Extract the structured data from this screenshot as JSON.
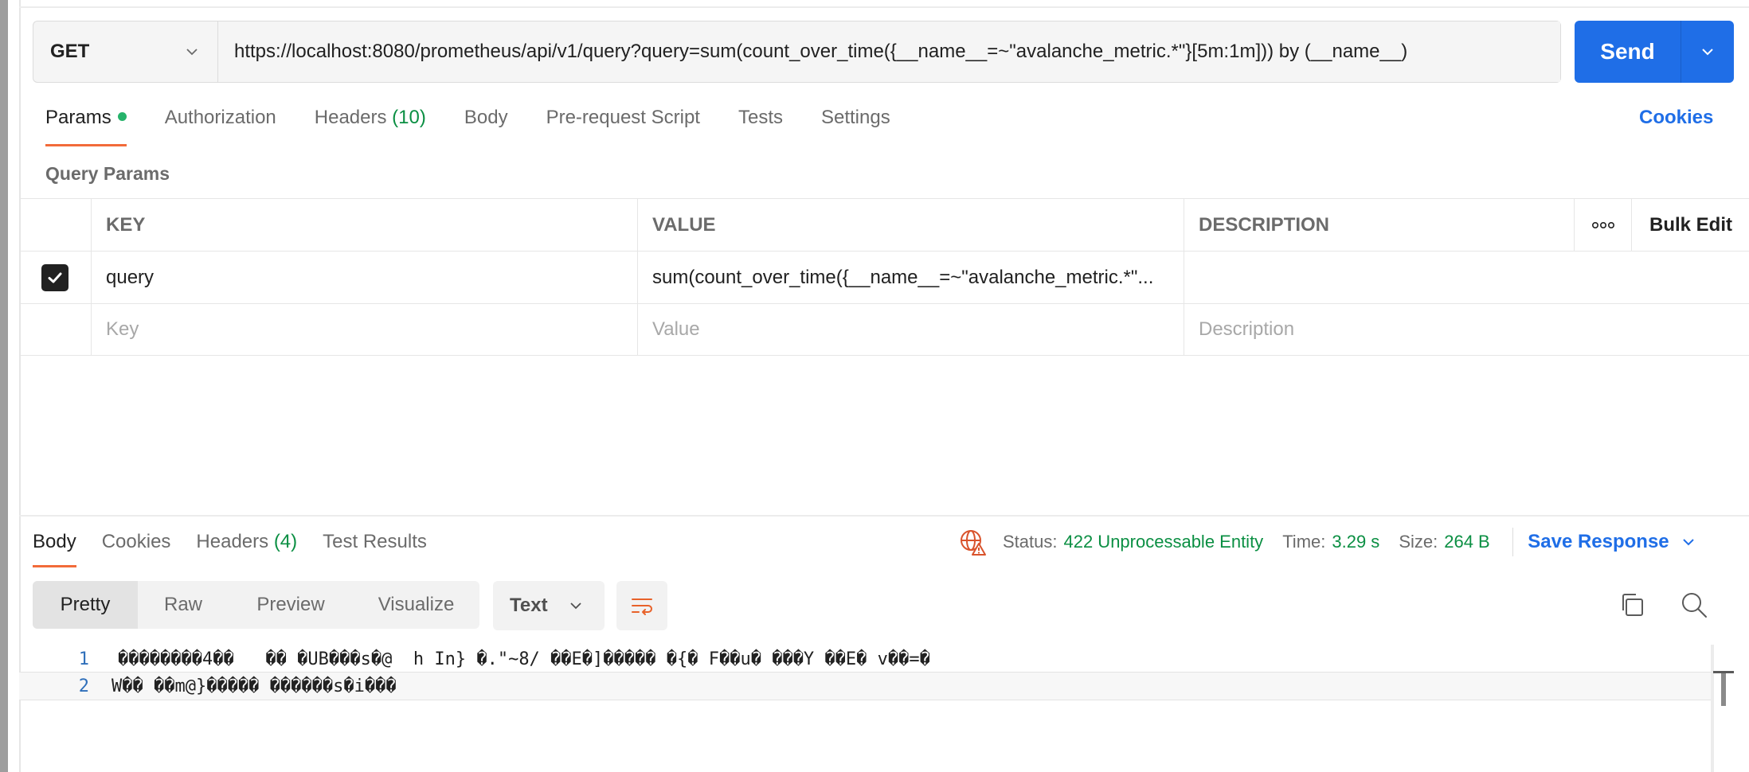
{
  "request": {
    "method": "GET",
    "url": "https://localhost:8080/prometheus/api/v1/query?query=sum(count_over_time({__name__=~\"avalanche_metric.*\"}[5m:1m])) by (__name__)",
    "send_label": "Send"
  },
  "tabs": {
    "params": "Params",
    "authorization": "Authorization",
    "headers": "Headers",
    "headers_count": "(10)",
    "body": "Body",
    "prerequest": "Pre-request Script",
    "tests": "Tests",
    "settings": "Settings",
    "cookies": "Cookies"
  },
  "params": {
    "title": "Query Params",
    "columns": {
      "key": "KEY",
      "value": "VALUE",
      "description": "DESCRIPTION",
      "bulk_edit": "Bulk Edit"
    },
    "rows": [
      {
        "key": "query",
        "value": "sum(count_over_time({__name__=~\"avalanche_metric.*\"...",
        "description": "",
        "checked": true
      }
    ],
    "placeholder": {
      "key": "Key",
      "value": "Value",
      "description": "Description"
    }
  },
  "response": {
    "tabs": {
      "body": "Body",
      "cookies": "Cookies",
      "headers": "Headers",
      "headers_count": "(4)",
      "test_results": "Test Results"
    },
    "status_label": "Status:",
    "status_value": "422 Unprocessable Entity",
    "time_label": "Time:",
    "time_value": "3.29 s",
    "size_label": "Size:",
    "size_value": "264 B",
    "save_response": "Save Response",
    "formats": [
      "Pretty",
      "Raw",
      "Preview",
      "Visualize"
    ],
    "language": "Text",
    "lines": [
      {
        "num": "1",
        "text": "��������4��   �� �UB���s�@  h In} �.\"~8/ ��E�]����� �{� F��u� ���Y ��E� v��=�"
      },
      {
        "num": "2",
        "text": "W�� ��m@}����� ������s�i���"
      }
    ]
  },
  "colors": {
    "accent": "#1f6ee7",
    "tab_underline": "#f26b3a",
    "status_green": "#0b8f43"
  }
}
